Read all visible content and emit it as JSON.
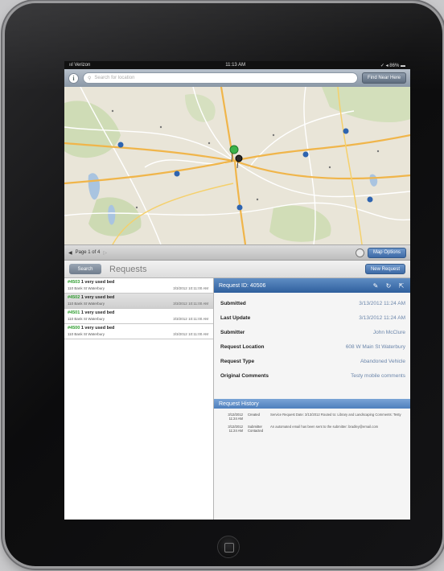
{
  "status_bar": {
    "carrier": "ııl Verizon",
    "time": "11:13 AM",
    "battery": "✓ ◂ 86% ▬"
  },
  "search": {
    "placeholder": "Search for location",
    "button_label": "Find Near Here"
  },
  "paging": {
    "label": "Page 1 of 4",
    "filter_button": "Map Options"
  },
  "tabs": {
    "search_label": "Search",
    "title": "Requests",
    "new_request_button": "New Request"
  },
  "requests": [
    {
      "id": "#4503",
      "title": "1 very used bed",
      "address": "110 Bank St Waterbury",
      "date": "3/3/2012 10:11:00 AM",
      "selected": false
    },
    {
      "id": "#4502",
      "title": "1 very used bed",
      "address": "110 Bank St Waterbury",
      "date": "3/3/2012 10:11:00 AM",
      "selected": true
    },
    {
      "id": "#4501",
      "title": "1 very used bed",
      "address": "110 Bank St Waterbury",
      "date": "3/3/2012 10:11:00 AM",
      "selected": false
    },
    {
      "id": "#4500",
      "title": "1 very used bed",
      "address": "110 Bank St Waterbury",
      "date": "3/3/2012 10:11:00 AM",
      "selected": false
    }
  ],
  "detail": {
    "title": "Request ID: 40506",
    "fields": [
      {
        "label": "Submitted",
        "value": "3/13/2012 11:24 AM"
      },
      {
        "label": "Last Update",
        "value": "3/13/2012 11:24 AM"
      },
      {
        "label": "Submitter",
        "value": "John McClure"
      },
      {
        "label": "Request Location",
        "value": "608 W Main St Waterbury"
      },
      {
        "label": "Request Type",
        "value": "Abandoned Vehicle"
      },
      {
        "label": "Original Comments",
        "value": "Testy mobile comments"
      }
    ],
    "history_title": "Request History",
    "history": [
      {
        "date": "3/13/2012 11:24 AM",
        "action": "Created",
        "note": "Service Request Date: 3/13/2012 Routed to: Library and Landscaping Comments: Testy"
      },
      {
        "date": "3/13/2012 11:24 AM",
        "action": "Submitter Contacted",
        "note": "An automated email has been sent to the submitter: bradley@email.com"
      }
    ]
  },
  "colors": {
    "header_blue": "#3d6aa6",
    "id_green": "#2f9d2f",
    "value_blue": "#6a85aa"
  }
}
